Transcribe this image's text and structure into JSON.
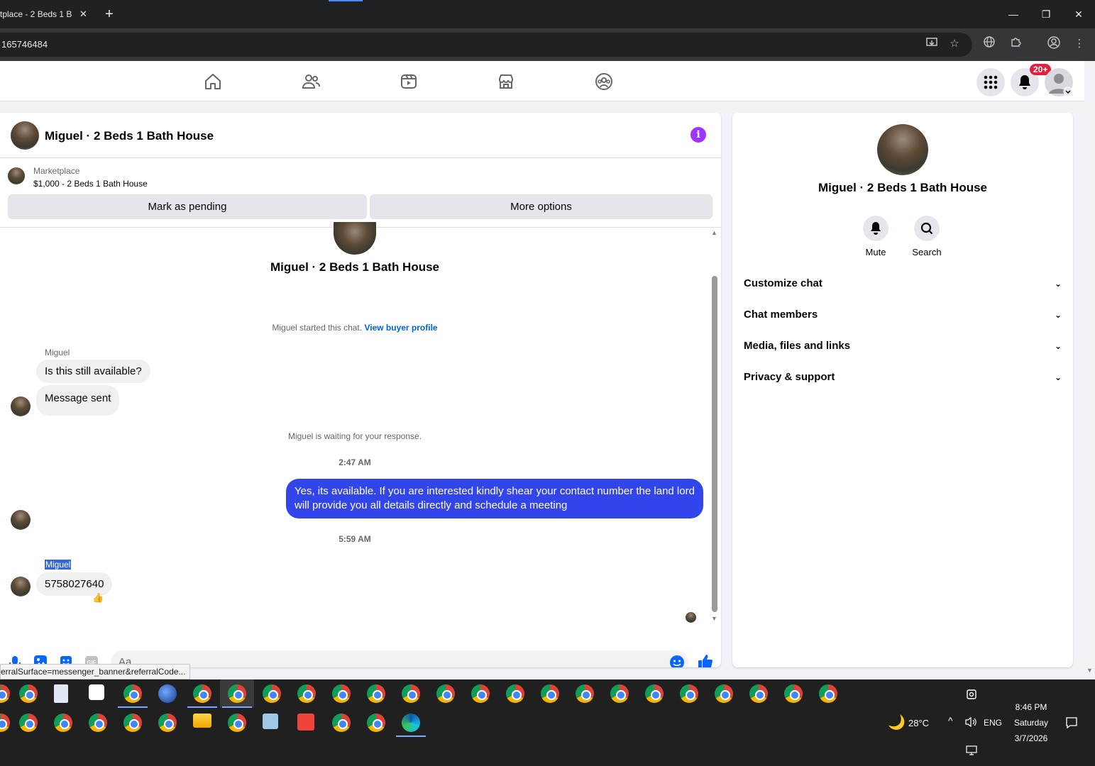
{
  "browser": {
    "tab_title": "tplace - 2 Beds 1 Ba",
    "tab_close": "✕",
    "new_tab": "+",
    "url": "165746484",
    "window_controls": {
      "minimize": "—",
      "maximize": "❐",
      "close": "✕"
    }
  },
  "header": {
    "notification_badge": "20+"
  },
  "chat": {
    "title": "Miguel · 2 Beds 1 Bath House",
    "info_glyph": "i",
    "marketplace_label": "Marketplace",
    "listing": "$1,000 - 2 Beds 1 Bath House",
    "mark_pending": "Mark as pending",
    "more_options": "More options",
    "intro_name": "Miguel · 2 Beds 1 Bath House",
    "started_text": "Miguel started this chat.",
    "view_buyer_profile": "View buyer profile",
    "messages": {
      "sender1": "Miguel",
      "msg1": "Is this still available?",
      "msg2": "Message sent",
      "waiting": "Miguel is waiting for your response.",
      "time1": "2:47 AM",
      "out1": "Yes, its available. If you are interested kindly shear your contact number the land lord will provide you all details directly and schedule a meeting",
      "time2": "5:59 AM",
      "sender2": "Miguel",
      "msg3": "5758027640",
      "reaction": "👍"
    },
    "composer_placeholder": "Aa"
  },
  "status_url": "erralSurface=messenger_banner&referralCode...",
  "right_panel": {
    "name": "Miguel · 2 Beds 1 Bath House",
    "mute": "Mute",
    "search": "Search",
    "sections": [
      "Customize chat",
      "Chat members",
      "Media, files and links",
      "Privacy & support"
    ]
  },
  "taskbar": {
    "weather": "28°C",
    "language": "ENG",
    "time": "8:46 PM",
    "day": "Saturday",
    "date": "3/7/2026"
  },
  "colors": {
    "accent_blue": "#3145eb",
    "link_blue": "#0064d1",
    "info_purple": "#a033ff",
    "badge_red": "#e41e3f"
  }
}
